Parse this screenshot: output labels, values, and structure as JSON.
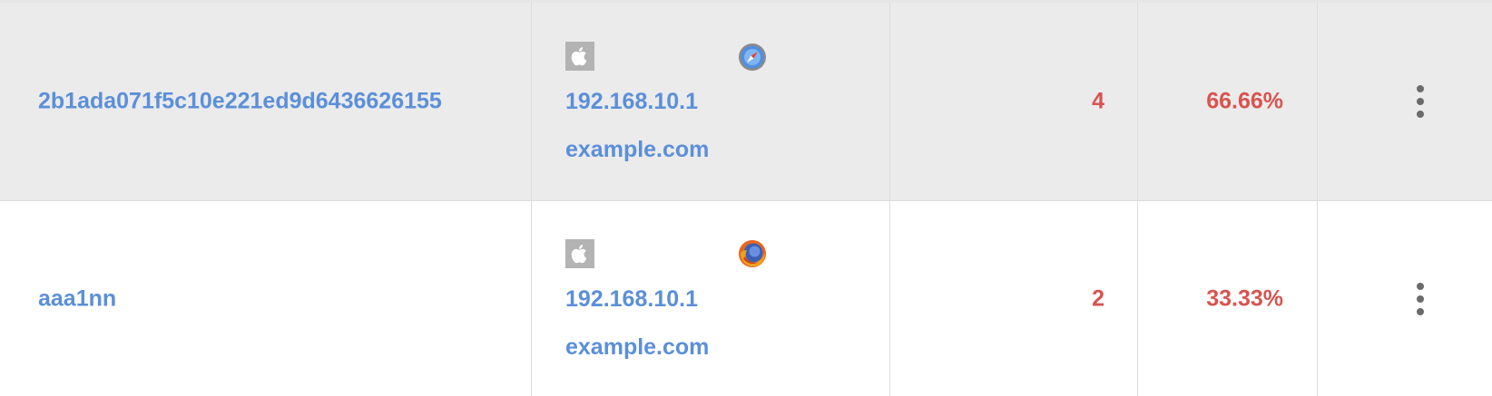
{
  "rows": [
    {
      "session_id": "2b1ada071f5c10e221ed9d6436626155",
      "os_icon": "apple-icon",
      "browser_icon": "safari-icon",
      "ip": "192.168.10.1",
      "host": "example.com",
      "count": "4",
      "percent": "66.66%"
    },
    {
      "session_id": "aaa1nn",
      "os_icon": "apple-icon",
      "browser_icon": "firefox-icon",
      "ip": "192.168.10.1",
      "host": "example.com",
      "count": "2",
      "percent": "33.33%"
    }
  ],
  "colors": {
    "link": "#5b8fd9",
    "value": "#d9534f",
    "row_alt": "#ebebeb"
  }
}
